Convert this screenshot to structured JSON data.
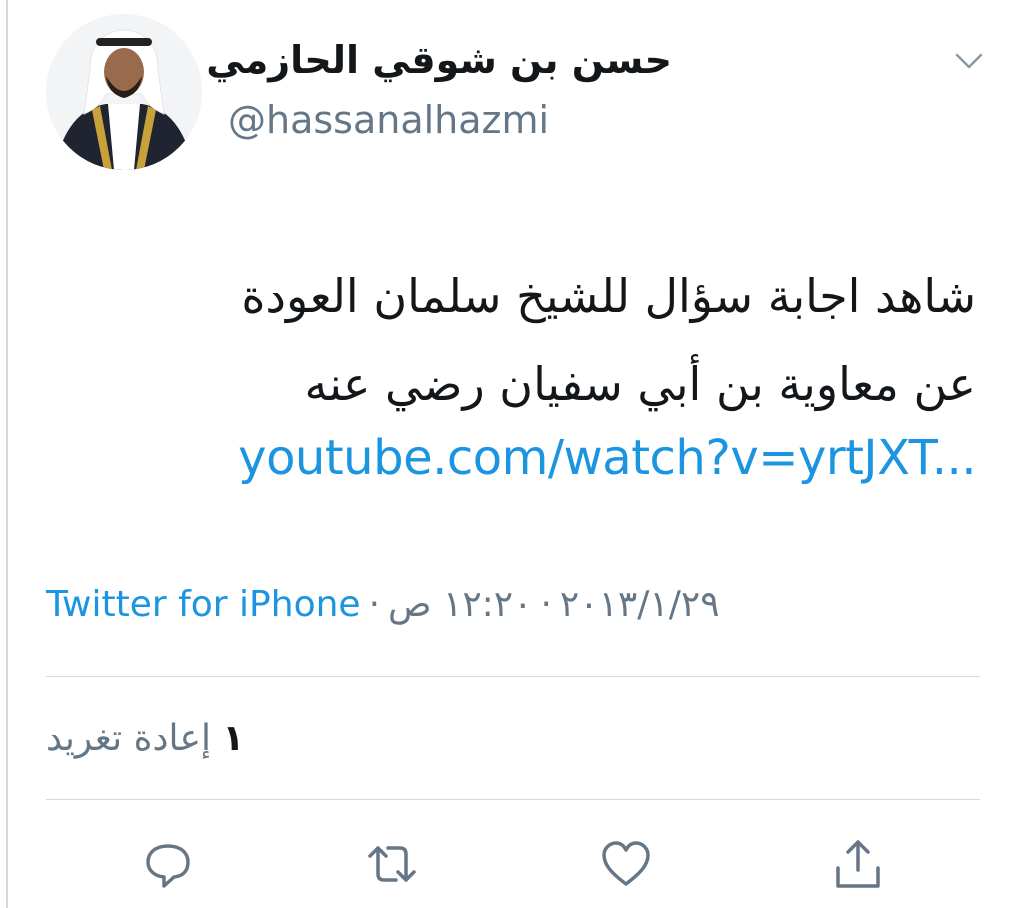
{
  "user": {
    "display_name": "حسن بن شوقي الحازمي",
    "handle": "@hassanalhazmi"
  },
  "tweet": {
    "text_line_1": "شاهد اجابة سؤال للشيخ سلمان العودة",
    "text_line_2": "عن معاوية بن أبي سفيان رضي عنه",
    "link": "youtube.com/watch?v=yrtJXT..."
  },
  "meta": {
    "time": "١٢:٢٠ ص",
    "date": "٢٠١٣/١/٢٩",
    "source": "Twitter for iPhone",
    "separator": "·"
  },
  "stats": {
    "retweet_count": "١",
    "retweet_label": "إعادة تغريد"
  },
  "icons": {
    "more": "chevron-down-icon",
    "reply": "reply-icon",
    "retweet": "retweet-icon",
    "like": "heart-icon",
    "share": "share-icon"
  },
  "colors": {
    "link": "#1b95e0",
    "secondary_text": "#657786",
    "primary_text": "#14171a",
    "divider": "#d6d9dc"
  }
}
